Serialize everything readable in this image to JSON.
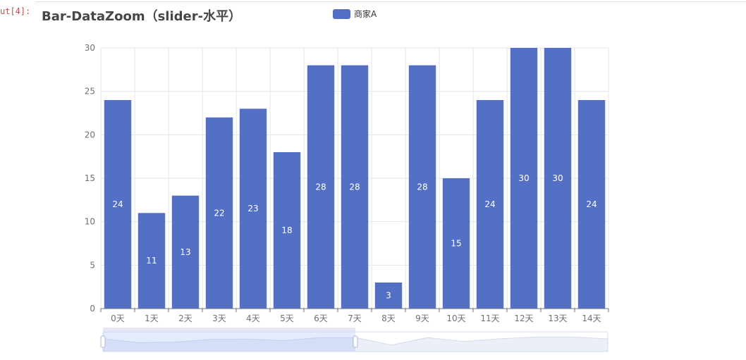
{
  "cell": {
    "prompt": "ut[4]:"
  },
  "chart_data": {
    "type": "bar",
    "title": "Bar-DataZoom（slider-水平）",
    "legend_position": "top-center",
    "categories": [
      "0天",
      "1天",
      "2天",
      "3天",
      "4天",
      "5天",
      "6天",
      "7天",
      "8天",
      "9天",
      "10天",
      "11天",
      "12天",
      "13天",
      "14天"
    ],
    "series": [
      {
        "name": "商家A",
        "values": [
          24,
          11,
          13,
          22,
          23,
          18,
          28,
          28,
          3,
          28,
          15,
          24,
          30,
          30,
          24
        ]
      }
    ],
    "ylim": [
      0,
      30
    ],
    "yticks": [
      0,
      5,
      10,
      15,
      20,
      25,
      30
    ],
    "grid": true,
    "data_labels": true,
    "datazoom": {
      "type": "slider",
      "orientation": "horizontal",
      "start_percent": 0,
      "end_percent": 50
    },
    "colors": {
      "bar": "#5470c6"
    }
  }
}
